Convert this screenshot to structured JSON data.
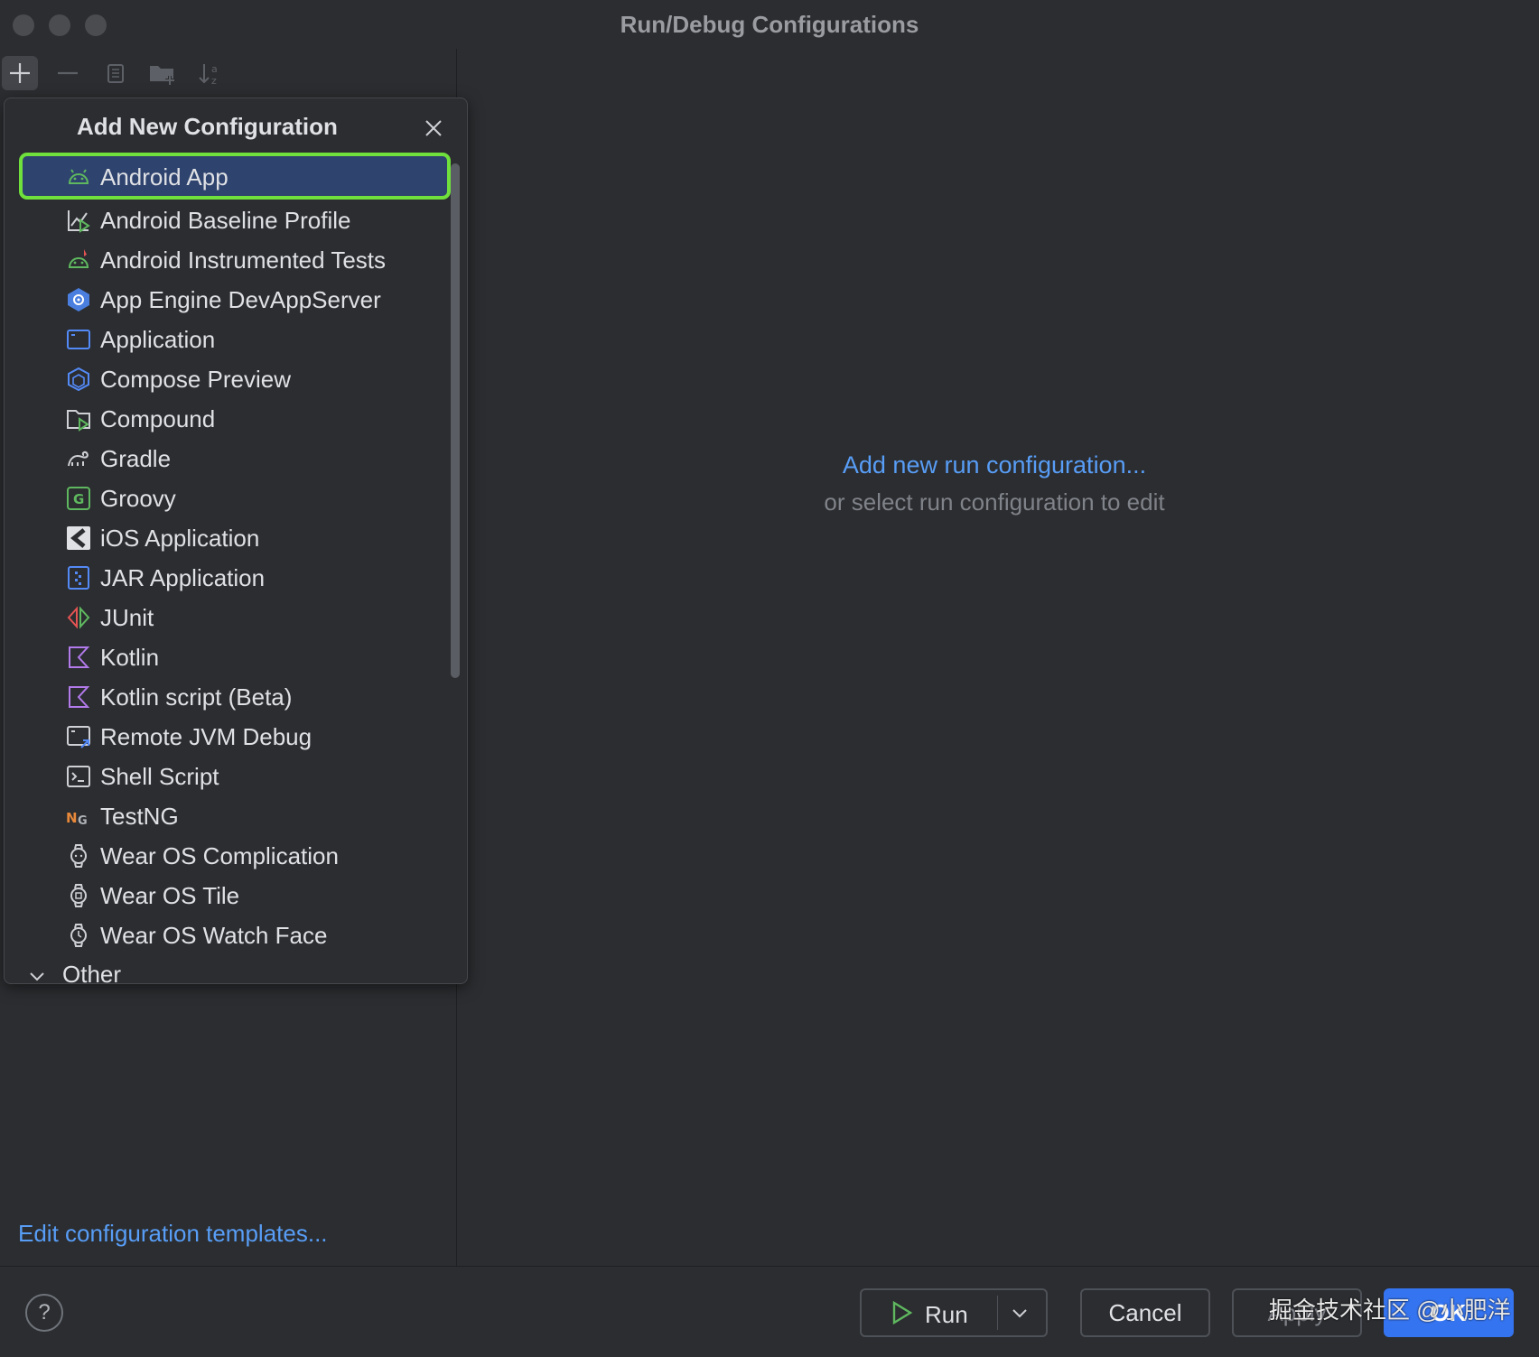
{
  "window": {
    "title": "Run/Debug Configurations"
  },
  "popup": {
    "title": "Add New Configuration",
    "items": [
      {
        "label": "Android App",
        "icon": "android-icon",
        "selected": true
      },
      {
        "label": "Android Baseline Profile",
        "icon": "baseline-profile-icon"
      },
      {
        "label": "Android Instrumented Tests",
        "icon": "instrumented-tests-icon"
      },
      {
        "label": "App Engine DevAppServer",
        "icon": "app-engine-icon"
      },
      {
        "label": "Application",
        "icon": "application-icon"
      },
      {
        "label": "Compose Preview",
        "icon": "compose-preview-icon"
      },
      {
        "label": "Compound",
        "icon": "compound-icon"
      },
      {
        "label": "Gradle",
        "icon": "gradle-icon"
      },
      {
        "label": "Groovy",
        "icon": "groovy-icon"
      },
      {
        "label": "iOS Application",
        "icon": "ios-application-icon"
      },
      {
        "label": "JAR Application",
        "icon": "jar-application-icon"
      },
      {
        "label": "JUnit",
        "icon": "junit-icon"
      },
      {
        "label": "Kotlin",
        "icon": "kotlin-icon"
      },
      {
        "label": "Kotlin script (Beta)",
        "icon": "kotlin-script-icon"
      },
      {
        "label": "Remote JVM Debug",
        "icon": "remote-debug-icon"
      },
      {
        "label": "Shell Script",
        "icon": "shell-script-icon"
      },
      {
        "label": "TestNG",
        "icon": "testng-icon"
      },
      {
        "label": "Wear OS Complication",
        "icon": "wear-os-icon"
      },
      {
        "label": "Wear OS Tile",
        "icon": "wear-os-icon"
      },
      {
        "label": "Wear OS Watch Face",
        "icon": "watch-face-icon"
      }
    ],
    "other_label": "Other"
  },
  "right": {
    "add_link": "Add new run configuration...",
    "sub_text": "or select run configuration to edit"
  },
  "left": {
    "templates_link": "Edit configuration templates..."
  },
  "buttons": {
    "help": "?",
    "run": "Run",
    "cancel": "Cancel",
    "apply": "Apply",
    "ok": "OK"
  },
  "watermark": "掘金技术社区 @小肥洋",
  "colors": {
    "accent": "#3574f0",
    "link": "#589df6",
    "selection": "#2e436e",
    "highlight_outline": "#6fe03c"
  }
}
